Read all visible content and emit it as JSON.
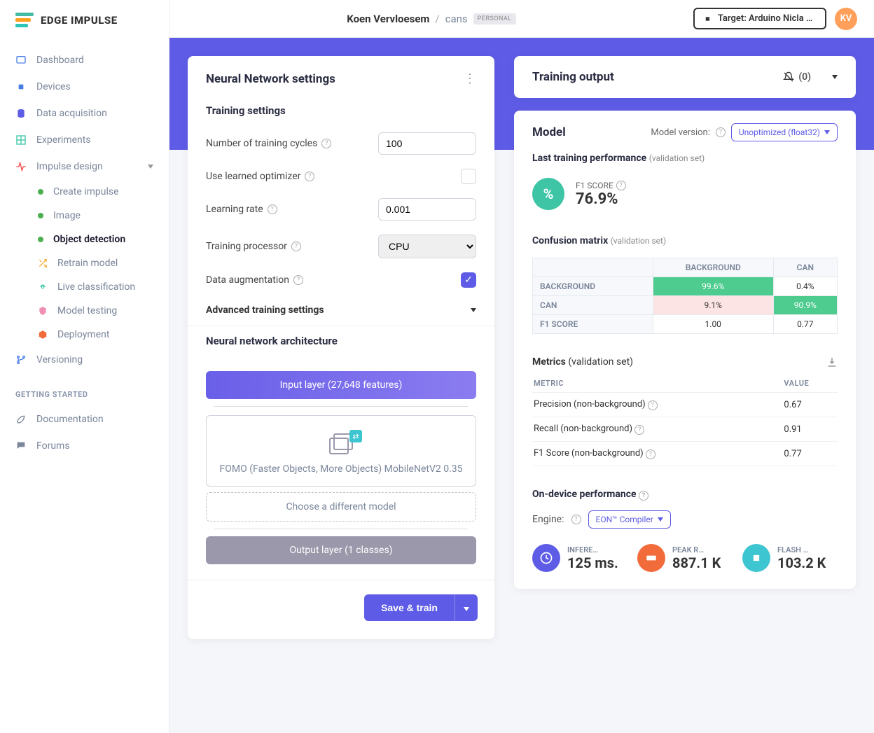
{
  "brand": "EDGE IMPULSE",
  "breadcrumb": {
    "user": "Koen Vervloesem",
    "project": "cans",
    "badge": "PERSONAL"
  },
  "target": "Target: Arduino Nicla Vis…",
  "avatar": "KV",
  "nav": {
    "dashboard": "Dashboard",
    "devices": "Devices",
    "data_acq": "Data acquisition",
    "experiments": "Experiments",
    "impulse": "Impulse design",
    "create_impulse": "Create impulse",
    "image": "Image",
    "object_detection": "Object detection",
    "retrain": "Retrain model",
    "live_class": "Live classification",
    "model_testing": "Model testing",
    "deployment": "Deployment",
    "versioning": "Versioning",
    "getting_started": "GETTING STARTED",
    "documentation": "Documentation",
    "forums": "Forums"
  },
  "settings": {
    "title": "Neural Network settings",
    "training_header": "Training settings",
    "cycles_label": "Number of training cycles",
    "cycles_value": "100",
    "learned_opt": "Use learned optimizer",
    "lr_label": "Learning rate",
    "lr_value": "0.001",
    "processor_label": "Training processor",
    "processor_value": "CPU",
    "augment_label": "Data augmentation",
    "advanced": "Advanced training settings",
    "arch_header": "Neural network architecture",
    "input_layer": "Input layer (27,648 features)",
    "model_name": "FOMO (Faster Objects, More Objects) MobileNetV2 0.35",
    "choose_model": "Choose a different model",
    "output_layer": "Output layer (1 classes)",
    "save_train": "Save & train"
  },
  "training_output": {
    "title": "Training output",
    "count": "(0)"
  },
  "model": {
    "title": "Model",
    "version_label": "Model version:",
    "version_value": "Unoptimized (float32)",
    "last_perf": "Last training performance",
    "validation_hint": "(validation set)",
    "f1_label": "F1 SCORE",
    "f1_value": "76.9%",
    "confusion_title": "Confusion matrix",
    "cm_cols": [
      "BACKGROUND",
      "CAN"
    ],
    "cm_rows": [
      {
        "label": "BACKGROUND",
        "cells": [
          {
            "v": "99.6%",
            "cls": "green"
          },
          {
            "v": "0.4%",
            "cls": ""
          }
        ]
      },
      {
        "label": "CAN",
        "cells": [
          {
            "v": "9.1%",
            "cls": "pink"
          },
          {
            "v": "90.9%",
            "cls": "green"
          }
        ]
      },
      {
        "label": "F1 SCORE",
        "cells": [
          {
            "v": "1.00",
            "cls": ""
          },
          {
            "v": "0.77",
            "cls": ""
          }
        ]
      }
    ],
    "metrics_title": "Metrics",
    "metrics_cols": [
      "METRIC",
      "VALUE"
    ],
    "metrics": [
      {
        "name": "Precision (non-background)",
        "value": "0.67"
      },
      {
        "name": "Recall (non-background)",
        "value": "0.91"
      },
      {
        "name": "F1 Score (non-background)",
        "value": "0.77"
      }
    ],
    "ondevice_title": "On-device performance",
    "engine_label": "Engine:",
    "engine_value": "EON™ Compiler",
    "perf": {
      "infer_label": "INFERE…",
      "infer_value": "125 ms.",
      "ram_label": "PEAK R…",
      "ram_value": "887.1 K",
      "flash_label": "FLASH …",
      "flash_value": "103.2 K"
    }
  }
}
